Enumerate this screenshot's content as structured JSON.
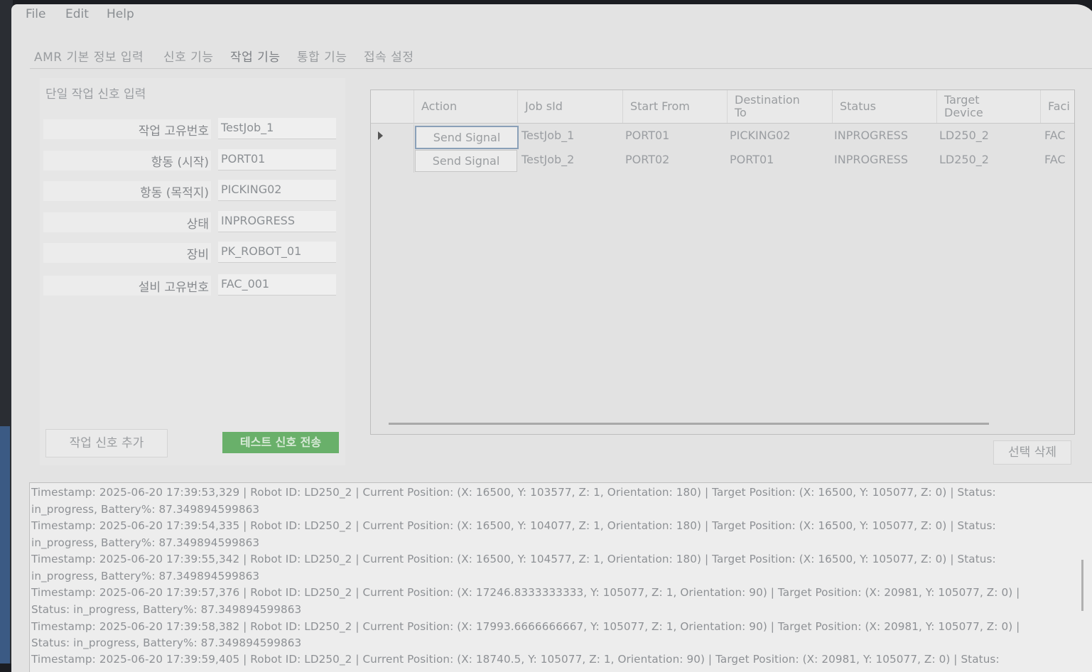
{
  "menu": {
    "file": "File",
    "edit": "Edit",
    "help": "Help"
  },
  "tabs": [
    "AMR 기본 정보 입력",
    "신호 기능",
    "작업 기능",
    "통합 기능",
    "접속 설정"
  ],
  "form": {
    "group_title": "단일 작업 신호 입력",
    "fields": [
      {
        "label": "작업 고유번호",
        "value": "TestJob_1"
      },
      {
        "label": "항동 (시작)",
        "value": "PORT01"
      },
      {
        "label": "항동 (목적지)",
        "value": "PICKING02"
      },
      {
        "label": "상태",
        "value": "INPROGRESS"
      },
      {
        "label": "장비",
        "value": "PK_ROBOT_01"
      },
      {
        "label": "설비 고유번호",
        "value": "FAC_001"
      }
    ],
    "add_button": "작업 신호 추가",
    "test_button": "테스트 신호 전송"
  },
  "grid": {
    "columns": [
      "Action",
      "Job sId",
      "Start From",
      "Destination To",
      "Status",
      "Target Device",
      "Faci"
    ],
    "rows": [
      {
        "action": "Send Signal",
        "job": "TestJob_1",
        "from": "PORT01",
        "to": "PICKING02",
        "status": "INPROGRESS",
        "device": "LD250_2",
        "fac": "FAC"
      },
      {
        "action": "Send Signal",
        "job": "TestJob_2",
        "from": "PORT02",
        "to": "PORT01",
        "status": "INPROGRESS",
        "device": "LD250_2",
        "fac": "FAC"
      }
    ]
  },
  "delete_button": "선택 삭제",
  "log": [
    "Timestamp: 2025-06-20 17:39:53,329 | Robot ID: LD250_2 | Current Position: (X: 16500, Y: 103577, Z: 1, Orientation: 180) | Target Position: (X: 16500, Y: 105077, Z: 0) | Status:",
    "in_progress, Battery%: 87.349894599863",
    "Timestamp: 2025-06-20 17:39:54,335 | Robot ID: LD250_2 | Current Position: (X: 16500, Y: 104077, Z: 1, Orientation: 180) | Target Position: (X: 16500, Y: 105077, Z: 0) | Status:",
    "in_progress, Battery%: 87.349894599863",
    "Timestamp: 2025-06-20 17:39:55,342 | Robot ID: LD250_2 | Current Position: (X: 16500, Y: 104577, Z: 1, Orientation: 180) | Target Position: (X: 16500, Y: 105077, Z: 0) | Status:",
    "in_progress, Battery%: 87.349894599863",
    "Timestamp: 2025-06-20 17:39:57,376 | Robot ID: LD250_2 | Current Position: (X: 17246.8333333333, Y: 105077, Z: 1, Orientation: 90) | Target Position: (X: 20981, Y: 105077, Z: 0) |",
    "Status: in_progress, Battery%: 87.349894599863",
    "Timestamp: 2025-06-20 17:39:58,382 | Robot ID: LD250_2 | Current Position: (X: 17993.6666666667, Y: 105077, Z: 1, Orientation: 90) | Target Position: (X: 20981, Y: 105077, Z: 0) |",
    "Status: in_progress, Battery%: 87.349894599863",
    "Timestamp: 2025-06-20 17:39:59,405 | Robot ID: LD250_2 | Current Position: (X: 18740.5, Y: 105077, Z: 1, Orientation: 90) | Target Position: (X: 20981, Y: 105077, Z: 0) | Status:"
  ]
}
